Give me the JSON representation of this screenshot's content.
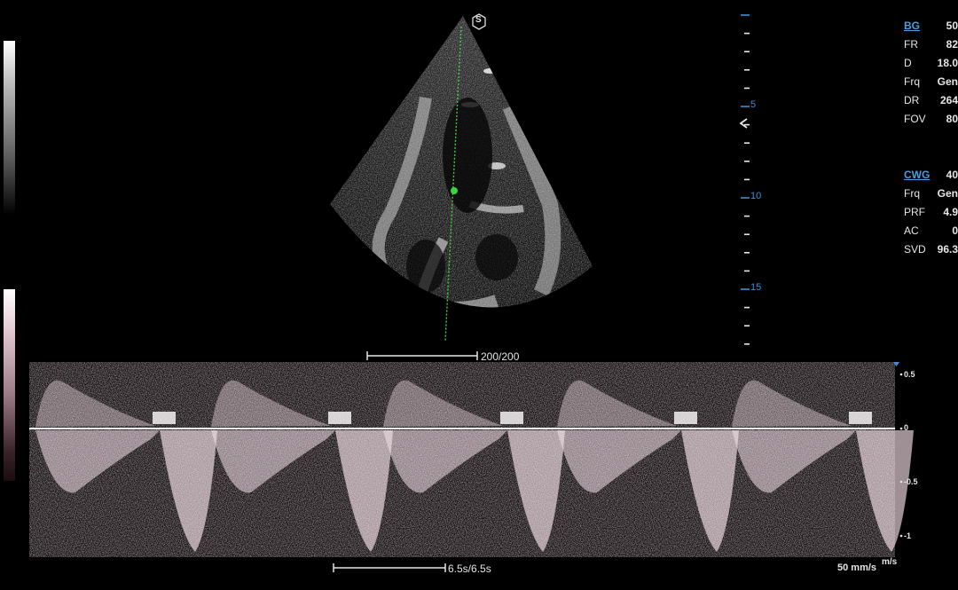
{
  "gray_scale_bar": {
    "name": "grayscale-bar"
  },
  "doppler_scale_bar": {
    "name": "doppler-color-bar"
  },
  "probe_marker": {
    "icon": "s-marker-icon",
    "text": "S"
  },
  "depth_scale": {
    "labels": [
      "5",
      "10",
      "15"
    ],
    "orientation_icon": "orientation-chevron-icon",
    "accent_color": "#3a8fd8"
  },
  "params": {
    "bg": {
      "label": "BG",
      "value": "50"
    },
    "fr": {
      "label": "FR",
      "value": "82"
    },
    "d": {
      "label": "D",
      "value": "18.0"
    },
    "frq": {
      "label": "Frq",
      "value": "Gen"
    },
    "dr": {
      "label": "DR",
      "value": "264"
    },
    "fov": {
      "label": "FOV",
      "value": "80"
    },
    "cwg": {
      "label": "CWG",
      "value": "40"
    },
    "frq2": {
      "label": "Frq",
      "value": "Gen"
    },
    "prf": {
      "label": "PRF",
      "value": "4.9"
    },
    "ac": {
      "label": "AC",
      "value": "0"
    },
    "svd": {
      "label": "SVD",
      "value": "96.3"
    }
  },
  "image_scale": {
    "text": "200/200"
  },
  "time_scale": {
    "text": "6.5s/6.5s"
  },
  "sweep_speed": {
    "text": "50 mm/s"
  },
  "velocity_axis": {
    "unit": "m/s",
    "labels": [
      "0.5",
      "0",
      "-0.5",
      "-1"
    ]
  },
  "colors": {
    "sample_line": "#3fd23f",
    "doppler_tint": "#f3dde5",
    "accent": "#4a9fe0"
  }
}
